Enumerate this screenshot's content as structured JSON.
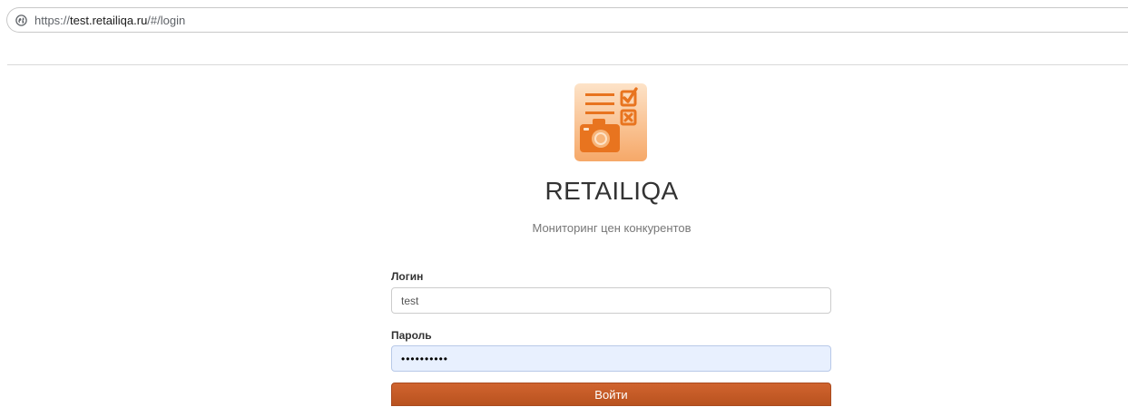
{
  "browser": {
    "url_scheme": "https://",
    "url_host": "test.retailiqa.ru",
    "url_path": "/#/login"
  },
  "brand": {
    "name": "RETAILIQA",
    "tagline": "Мониторинг цен конкурентов"
  },
  "login_form": {
    "login_label": "Логин",
    "login_value": "test",
    "password_label": "Пароль",
    "password_mask": "••••••••••",
    "submit_label": "Войти"
  },
  "icons": {
    "site_info": "site-info-icon",
    "logo": "retailiqa-logo-icon"
  },
  "colors": {
    "accent": "#c85a27",
    "logo_bg": "#f7b57a",
    "logo_mark": "#e8741f",
    "autofill_bg": "#e8f0fe"
  }
}
